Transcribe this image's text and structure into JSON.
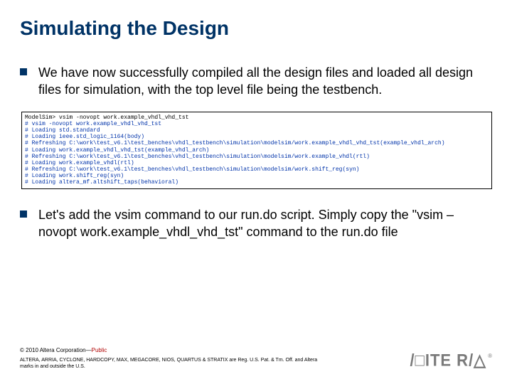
{
  "title": "Simulating the Design",
  "bullets": {
    "b1": "We have now successfully compiled all the design files and loaded all design files for simulation, with the top level file being the testbench.",
    "b2": "Let's add the vsim command to our run.do script.  Simply copy the \"vsim –novopt work.example_vhdl_vhd_tst\" command to the run.do file"
  },
  "terminal": {
    "line1": "ModelSim> vsim -novopt work.example_vhdl_vhd_tst",
    "line2": "# vsim -novopt work.example_vhdl_vhd_tst",
    "line3": "# Loading std.standard",
    "line4": "# Loading ieee.std_logic_1164(body)",
    "line5": "# Refreshing C:\\work\\test_v6.1\\test_benches\\vhdl_testbench\\simulation\\modelsim/work.example_vhdl_vhd_tst(example_vhdl_arch)",
    "line6": "# Loading work.example_vhdl_vhd_tst(example_vhdl_arch)",
    "line7": "# Refreshing C:\\work\\test_v6.1\\test_benches\\vhdl_testbench\\simulation\\modelsim/work.example_vhdl(rtl)",
    "line8": "# Loading work.example_vhdl(rtl)",
    "line9": "# Refreshing C:\\work\\test_v6.1\\test_benches\\vhdl_testbench\\simulation\\modelsim/work.shift_reg(syn)",
    "line10": "# Loading work.shift_reg(syn)",
    "line11": "# Loading altera_mf.altshift_taps(behavioral)"
  },
  "footer": {
    "copyright_pre": "© 2010 Altera Corporation—",
    "copyright_pub": "Public",
    "legal": "ALTERA, ARRIA, CYCLONE, HARDCOPY, MAX, MEGACORE, NIOS, QUARTUS & STRATIX are Reg. U.S. Pat. & Tm. Off. and Altera marks in and outside the U.S."
  },
  "logo": {
    "text": "/□ITE R/△",
    "reg": "®"
  }
}
